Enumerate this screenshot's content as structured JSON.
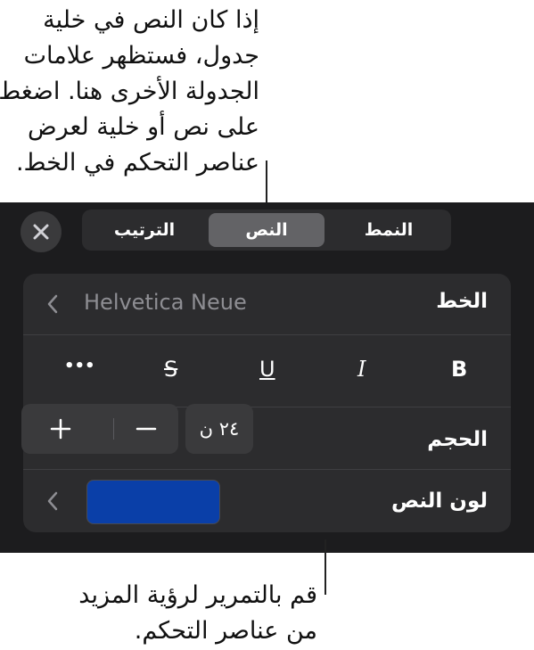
{
  "callout_top": {
    "lines": [
      "إذا كان النص في خلية",
      "جدول، فستظهر علامات",
      "الجدولة الأخرى هنا. اضغط",
      "على نص أو خلية لعرض",
      "عناصر التحكم في الخط."
    ]
  },
  "callout_bottom": {
    "lines": [
      "قم بالتمرير لرؤية المزيد",
      "من عناصر التحكم."
    ]
  },
  "toolbar": {
    "close_icon": "close-icon",
    "tabs": [
      {
        "label": "الترتيب",
        "selected": false
      },
      {
        "label": "النص",
        "selected": true
      },
      {
        "label": "النمط",
        "selected": false
      }
    ]
  },
  "font_row": {
    "label": "الخط",
    "value": "Helvetica Neue",
    "icon": "chevron-left-icon"
  },
  "style_row": {
    "buttons": [
      {
        "name": "more",
        "glyph": "•••"
      },
      {
        "name": "strikethrough",
        "glyph": "S"
      },
      {
        "name": "underline",
        "glyph": "U"
      },
      {
        "name": "italic",
        "glyph": "I"
      },
      {
        "name": "bold",
        "glyph": "B"
      }
    ]
  },
  "size_row": {
    "label": "الحجم",
    "value": "٢٤ ن",
    "increment_icon": "plus-icon",
    "decrement_icon": "minus-icon"
  },
  "color_row": {
    "label": "لون النص",
    "swatch_color": "#0a3fa8",
    "icon": "chevron-left-icon"
  },
  "colors": {
    "panel_bg": "#1c1c1e",
    "card_bg": "#2c2c2e",
    "selected_segment": "#636366"
  }
}
